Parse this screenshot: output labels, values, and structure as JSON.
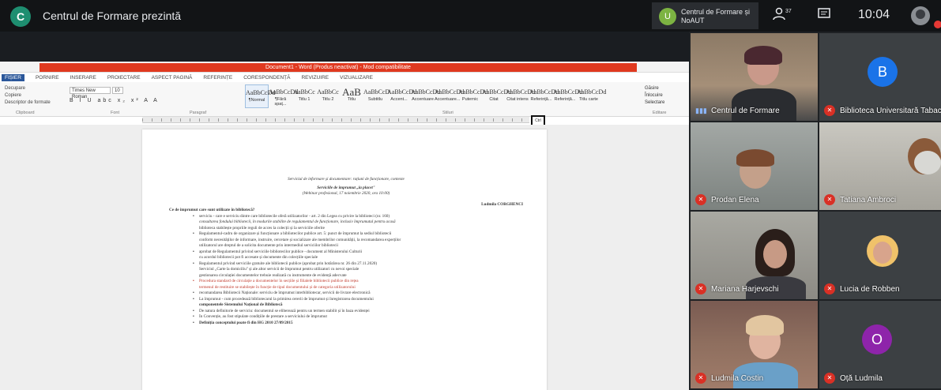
{
  "topbar": {
    "presenter_initial": "C",
    "presenting_label": "Centrul de Formare prezintă",
    "chip_initial": "U",
    "chip_text": "Centrul de Formare și NoAUT",
    "participants_icon": "people-icon",
    "chat_icon": "chat-icon",
    "time": "10:04",
    "accent": "#1e8e70"
  },
  "ribbon": {
    "title_banner": "Document1 - Word (Produs neactivat) - Mod compatibilitate",
    "tabs": [
      "FIȘIER",
      "PORNIRE",
      "INSERARE",
      "PROIECTARE",
      "ASPECT PAGINĂ",
      "REFERINȚE",
      "CORESPONDENȚĂ",
      "REVIZUIRE",
      "VIZUALIZARE"
    ],
    "clipboard": [
      "Decupare",
      "Copiere",
      "Descriptor de formate"
    ],
    "font_name": "Times New Roman",
    "font_size": "10",
    "format_row": "B I U abc x₂ x² A A",
    "styles": [
      {
        "preview": "AaBbCcDd",
        "label": "¶Normal"
      },
      {
        "preview": "AaBbCcDd",
        "label": "¶Fără spaț..."
      },
      {
        "preview": "AaBbCc",
        "label": "Titlu 1"
      },
      {
        "preview": "AaBbCc",
        "label": "Titlu 2"
      },
      {
        "preview": "AaB",
        "label": "Titlu"
      },
      {
        "preview": "AaBbCcD",
        "label": "Subtitlu"
      },
      {
        "preview": "AaBbCcDd",
        "label": "Accent..."
      },
      {
        "preview": "AaBbCcDd",
        "label": "Accentuare"
      },
      {
        "preview": "AaBbCcDd",
        "label": "Accentuare..."
      },
      {
        "preview": "AaBbCcDd",
        "label": "Puternic"
      },
      {
        "preview": "AaBbCcDd",
        "label": "Citat"
      },
      {
        "preview": "AaBbCcDd",
        "label": "Citat intens"
      },
      {
        "preview": "AaBbCcDd",
        "label": "Referință..."
      },
      {
        "preview": "AaBbCcDd",
        "label": "Referință..."
      },
      {
        "preview": "AaBbCcDd",
        "label": "Titlu carte"
      }
    ],
    "editing": [
      "Găsire",
      "Înlocuire",
      "Selectare"
    ],
    "groups": [
      "Clipboard",
      "Font",
      "Paragraf",
      "Stiluri",
      "Editare"
    ],
    "highlight_label": "Ctrl"
  },
  "document": {
    "line1": "Serviciul de informare și documentare: rațiuni de funcționare, contexte",
    "line2": "Serviciile de împrumut „la placet\"",
    "line3": "(Webinar profesional, 17 noiembrie 2020, ora 10:00)",
    "author": "Ludmila CORGHENCI",
    "question": "Ce de împrumut care sunt utilizate în bibliotecă?",
    "bullets": [
      "serviciu - care e serviciu dintre care bibliotecile oferă utilizatorilor - art. 2 din Legea cu privire la biblioteci (nr. 160)",
      "consultarea fondului bibliotecii, în modurile stabilite de regulamentul de funcționare, inclusiv împrumutul pentru acasă",
      "Regulamentul-cadru de organizare și funcționare a bibliotecilor publice art. 5: punct de împrumut la sediul bibliotecii",
      "conform necesităților de informare, instruire, cercetare și socializare ale membrilor comunității, la recomandarea experților",
      "aprobat de Regulamentul privind serviciile bibliotecilor publice - document al Ministerului Culturii",
      "Regulamentul privind serviciile gratuite ale bibliotecii publice (aprobat prin hotărârea nr. 26 din 27.11.2020)",
      "Serviciul „Carte la domiciliu\" și ale altor servicii de împrumut pentru utilizatori cu nevoi speciale",
      "Procedura standard de circulație a documentelor în secțiile și filialele bibliotecii publice din rețea",
      "recomandarea Bibliotecii Naționale: serviciu de împrumut interbibliotecar, servicii de livrare electronică",
      "La împrumut - cum procedează bibliotecarul la primirea cererii de împrumut și înregistrarea documentului",
      "componentele Sistemului Național de Bibliotecă",
      "De natura definitorie de serviciu: documentul se eliberează pentru un termen stabilit și în baza evidenței",
      "În Convenție, au fost stipulate condițiile de prestare a serviciului de împrumut",
      "Definiția conceptului poate fi din HG 2010 27/09/2015"
    ],
    "continuations": [
      "biblioteca stabilește propriile reguli de acces la colecții și la serviciile oferite",
      "utilizatorul are dreptul de a solicita documente prin intermediul serviciilor bibliotecii",
      "cu acordul bibliotecii pot fi accesate și documente din colecțiile speciale",
      "gestionarea circulației documentelor trebuie realizată cu instrumente de evidență adecvate",
      "termenul de restituire se stabilește în funcție de tipul documentului și de categoria utilizatorului"
    ]
  },
  "participants": [
    {
      "name": "Centrul de Formare",
      "type": "video",
      "muted": false,
      "bg": "#6b5a4a"
    },
    {
      "name": "Biblioteca Universitară Tabacu",
      "type": "avatar",
      "initial": "B",
      "color": "#1a73e8",
      "muted": true
    },
    {
      "name": "Prodan Elena",
      "type": "video",
      "muted": true,
      "bg": "#8a8f8d"
    },
    {
      "name": "Tatiana Ambroci",
      "type": "video",
      "muted": true,
      "bg": "#b9b7b0"
    },
    {
      "name": "Mariana Harjevschi",
      "type": "video",
      "muted": true,
      "bg": "#9b9b94"
    },
    {
      "name": "Lucia de Robben",
      "type": "photo",
      "muted": true
    },
    {
      "name": "Ludmila Costin",
      "type": "video",
      "muted": true,
      "bg": "#7a5b52"
    },
    {
      "name": "Oță Ludmila",
      "type": "avatar",
      "initial": "O",
      "color": "#8e24aa",
      "muted": true
    }
  ]
}
